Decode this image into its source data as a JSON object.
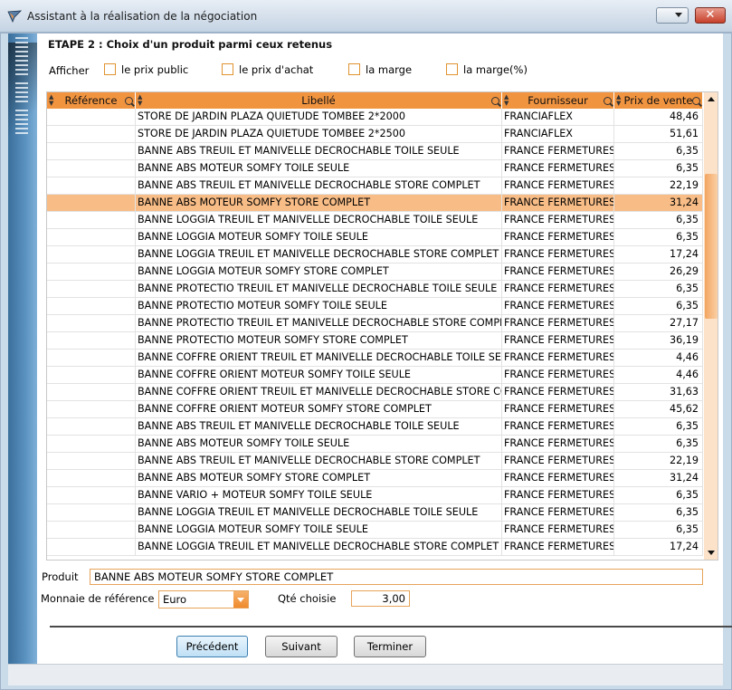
{
  "window": {
    "title": "Assistant à la réalisation de la négociation",
    "close_label": "✕"
  },
  "step_title": "ETAPE 2 : Choix d'un produit parmi ceux retenus",
  "afficher": {
    "label": "Afficher",
    "options": [
      "le prix public",
      "le prix d'achat",
      "la marge",
      "la marge(%)"
    ]
  },
  "grid": {
    "columns": [
      "Référence",
      "Libellé",
      "Fournisseur",
      "Prix de vente"
    ],
    "selected_index": 5,
    "rows": [
      {
        "ref": "",
        "libelle": "STORE DE JARDIN PLAZA QUIETUDE TOMBEE 2*2000",
        "fournisseur": "FRANCIAFLEX",
        "prix": "48,46"
      },
      {
        "ref": "",
        "libelle": "STORE DE JARDIN PLAZA QUIETUDE TOMBEE 2*2500",
        "fournisseur": "FRANCIAFLEX",
        "prix": "51,61"
      },
      {
        "ref": "",
        "libelle": "BANNE ABS TREUIL ET MANIVELLE DECROCHABLE TOILE SEULE",
        "fournisseur": "FRANCE FERMETURES",
        "prix": "6,35"
      },
      {
        "ref": "",
        "libelle": "BANNE ABS MOTEUR SOMFY TOILE SEULE",
        "fournisseur": "FRANCE FERMETURES",
        "prix": "6,35"
      },
      {
        "ref": "",
        "libelle": "BANNE ABS TREUIL ET MANIVELLE DECROCHABLE STORE COMPLET",
        "fournisseur": "FRANCE FERMETURES",
        "prix": "22,19"
      },
      {
        "ref": "",
        "libelle": "BANNE ABS MOTEUR SOMFY STORE COMPLET",
        "fournisseur": "FRANCE FERMETURES",
        "prix": "31,24"
      },
      {
        "ref": "",
        "libelle": "BANNE LOGGIA TREUIL ET MANIVELLE DECROCHABLE TOILE SEULE",
        "fournisseur": "FRANCE FERMETURES",
        "prix": "6,35"
      },
      {
        "ref": "",
        "libelle": "BANNE LOGGIA MOTEUR SOMFY TOILE SEULE",
        "fournisseur": "FRANCE FERMETURES",
        "prix": "6,35"
      },
      {
        "ref": "",
        "libelle": "BANNE LOGGIA TREUIL ET MANIVELLE DECROCHABLE STORE COMPLET",
        "fournisseur": "FRANCE FERMETURES",
        "prix": "17,24"
      },
      {
        "ref": "",
        "libelle": "BANNE LOGGIA MOTEUR SOMFY STORE COMPLET",
        "fournisseur": "FRANCE FERMETURES",
        "prix": "26,29"
      },
      {
        "ref": "",
        "libelle": "BANNE PROTECTIO TREUIL ET MANIVELLE DECROCHABLE TOILE SEULE",
        "fournisseur": "FRANCE FERMETURES",
        "prix": "6,35"
      },
      {
        "ref": "",
        "libelle": "BANNE PROTECTIO MOTEUR SOMFY TOILE SEULE",
        "fournisseur": "FRANCE FERMETURES",
        "prix": "6,35"
      },
      {
        "ref": "",
        "libelle": "BANNE PROTECTIO TREUIL ET MANIVELLE DECROCHABLE STORE COMPLET",
        "fournisseur": "FRANCE FERMETURES",
        "prix": "27,17"
      },
      {
        "ref": "",
        "libelle": "BANNE PROTECTIO MOTEUR SOMFY STORE COMPLET",
        "fournisseur": "FRANCE FERMETURES",
        "prix": "36,19"
      },
      {
        "ref": "",
        "libelle": "BANNE COFFRE ORIENT TREUIL ET MANIVELLE DECROCHABLE TOILE SEULE",
        "fournisseur": "FRANCE FERMETURES",
        "prix": "4,46"
      },
      {
        "ref": "",
        "libelle": "BANNE COFFRE ORIENT MOTEUR SOMFY TOILE SEULE",
        "fournisseur": "FRANCE FERMETURES",
        "prix": "4,46"
      },
      {
        "ref": "",
        "libelle": "BANNE COFFRE ORIENT TREUIL ET MANIVELLE DECROCHABLE STORE COMPLET",
        "fournisseur": "FRANCE FERMETURES",
        "prix": "31,63"
      },
      {
        "ref": "",
        "libelle": "BANNE COFFRE ORIENT MOTEUR SOMFY STORE COMPLET",
        "fournisseur": "FRANCE FERMETURES",
        "prix": "45,62"
      },
      {
        "ref": "",
        "libelle": "BANNE ABS TREUIL ET MANIVELLE DECROCHABLE TOILE SEULE",
        "fournisseur": "FRANCE FERMETURES",
        "prix": "6,35"
      },
      {
        "ref": "",
        "libelle": "BANNE ABS MOTEUR SOMFY TOILE SEULE",
        "fournisseur": "FRANCE FERMETURES",
        "prix": "6,35"
      },
      {
        "ref": "",
        "libelle": "BANNE ABS TREUIL ET MANIVELLE DECROCHABLE STORE COMPLET",
        "fournisseur": "FRANCE FERMETURES",
        "prix": "22,19"
      },
      {
        "ref": "",
        "libelle": "BANNE ABS MOTEUR SOMFY STORE COMPLET",
        "fournisseur": "FRANCE FERMETURES",
        "prix": "31,24"
      },
      {
        "ref": "",
        "libelle": "BANNE VARIO + MOTEUR SOMFY TOILE SEULE",
        "fournisseur": "FRANCE FERMETURES",
        "prix": "6,35"
      },
      {
        "ref": "",
        "libelle": "BANNE LOGGIA TREUIL ET MANIVELLE DECROCHABLE TOILE SEULE",
        "fournisseur": "FRANCE FERMETURES",
        "prix": "6,35"
      },
      {
        "ref": "",
        "libelle": "BANNE LOGGIA MOTEUR SOMFY TOILE SEULE",
        "fournisseur": "FRANCE FERMETURES",
        "prix": "6,35"
      },
      {
        "ref": "",
        "libelle": "BANNE LOGGIA TREUIL ET MANIVELLE DECROCHABLE STORE COMPLET",
        "fournisseur": "FRANCE FERMETURES",
        "prix": "17,24"
      }
    ]
  },
  "form": {
    "produit_label": "Produit",
    "produit_value": "BANNE ABS MOTEUR SOMFY STORE COMPLET",
    "monnaie_label": "Monnaie de référence",
    "monnaie_value": "Euro",
    "qte_label": "Qté choisie",
    "qte_value": "3,00"
  },
  "buttons": {
    "precedent": "Précédent",
    "suivant": "Suivant",
    "terminer": "Terminer"
  },
  "colors": {
    "accent": "#f19440",
    "selected_row": "#f8bd87"
  }
}
